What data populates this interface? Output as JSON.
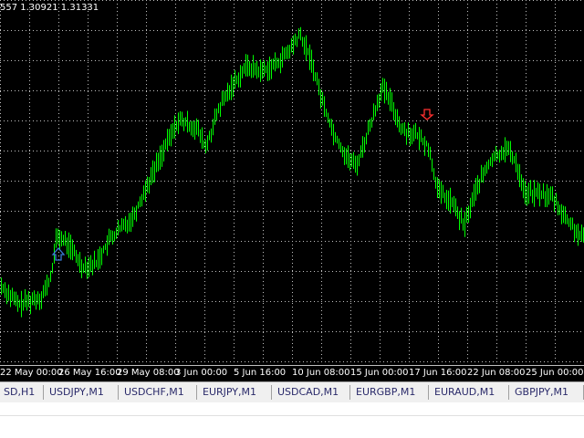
{
  "chart": {
    "ohlc_readout": "557 1.30921 1.31331",
    "background": "#000000",
    "candle_color": "#00ff00",
    "grid_color": "#c0c0c0",
    "arrow_up_color": "#3a7bd5",
    "arrow_down_color": "#ff3030",
    "arrow_up_icon": "up-arrow-icon",
    "arrow_down_icon": "down-arrow-icon"
  },
  "time_axis": [
    "22 May 00:00",
    "26 May 16:00",
    "29 May 08:00",
    "3 Jun 00:00",
    "5 Jun 16:00",
    "10 Jun 08:00",
    "15 Jun 00:00",
    "17 Jun 16:00",
    "22 Jun 08:00",
    "25 Jun 00:00"
  ],
  "tabs": [
    "SD,H1",
    "USDJPY,M1",
    "USDCHF,M1",
    "EURJPY,M1",
    "USDCAD,M1",
    "EURGBP,M1",
    "EURAUD,M1",
    "GBPJPY,M1"
  ]
}
